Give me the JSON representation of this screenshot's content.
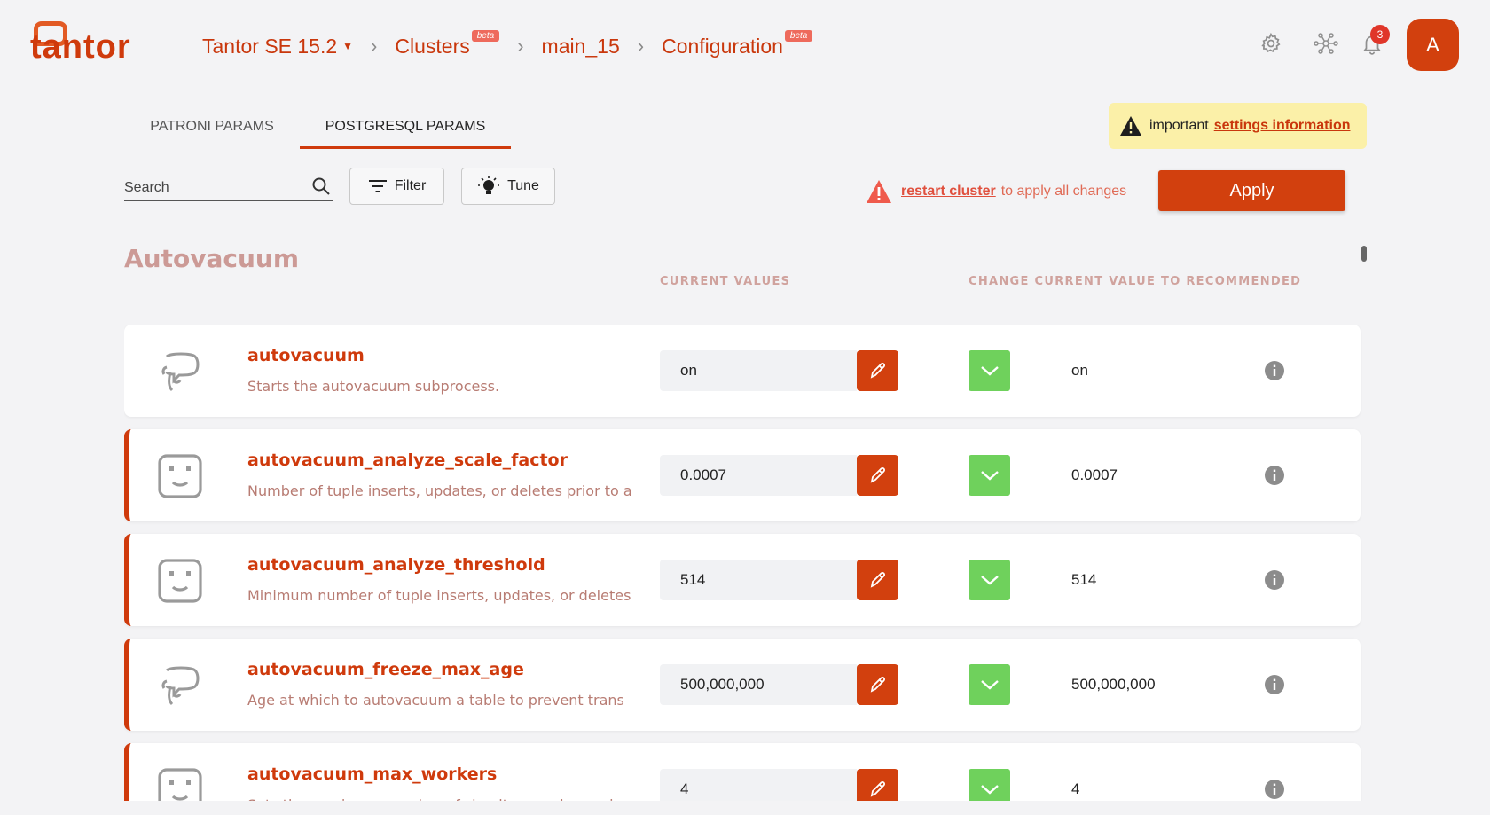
{
  "brand": {
    "logo_text": "tantor"
  },
  "breadcrumbs": [
    {
      "label": "Tantor SE 15.2"
    },
    {
      "label": "Clusters",
      "tag": "beta"
    },
    {
      "label": "main_15"
    },
    {
      "label": "Configuration",
      "tag": "beta"
    }
  ],
  "header": {
    "notifications_count": "3",
    "avatar_letter": "A"
  },
  "tabs": [
    {
      "label": "PATRONI PARAMS",
      "active": false
    },
    {
      "label": "POSTGRESQL PARAMS",
      "active": true
    }
  ],
  "notice": {
    "prefix": "important",
    "link": "settings information"
  },
  "toolbar": {
    "search_placeholder": "Search",
    "filter_label": "Filter",
    "tune_label": "Tune",
    "restart_link": "restart cluster",
    "restart_suffix": "to apply all changes",
    "apply_label": "Apply"
  },
  "section": {
    "title": "Autovacuum",
    "col_current": "CURRENT VALUES",
    "col_recommended": "CHANGE CURRENT VALUE TO RECOMMENDED"
  },
  "params": [
    {
      "name": "autovacuum",
      "description": "Starts the autovacuum subprocess.",
      "current": "on",
      "recommended": "on",
      "modified": false,
      "icon": "postgres-elephant-icon"
    },
    {
      "name": "autovacuum_analyze_scale_factor",
      "description": "Number of tuple inserts, updates, or deletes prior to a",
      "current": "0.0007",
      "recommended": "0.0007",
      "modified": true,
      "icon": "tantor-dice-icon"
    },
    {
      "name": "autovacuum_analyze_threshold",
      "description": "Minimum number of tuple inserts, updates, or deletes",
      "current": "514",
      "recommended": "514",
      "modified": true,
      "icon": "tantor-dice-icon"
    },
    {
      "name": "autovacuum_freeze_max_age",
      "description": "Age at which to autovacuum a table to prevent trans",
      "current": "500,000,000",
      "recommended": "500,000,000",
      "modified": true,
      "icon": "postgres-elephant-icon"
    },
    {
      "name": "autovacuum_max_workers",
      "description": "Sets the maximum number of simultaneously running",
      "current": "4",
      "recommended": "4",
      "modified": true,
      "icon": "tantor-dice-icon"
    }
  ],
  "colors": {
    "accent": "#cf3a0c",
    "accept": "#6fd15c",
    "notice_bg": "#fbf0a8"
  }
}
